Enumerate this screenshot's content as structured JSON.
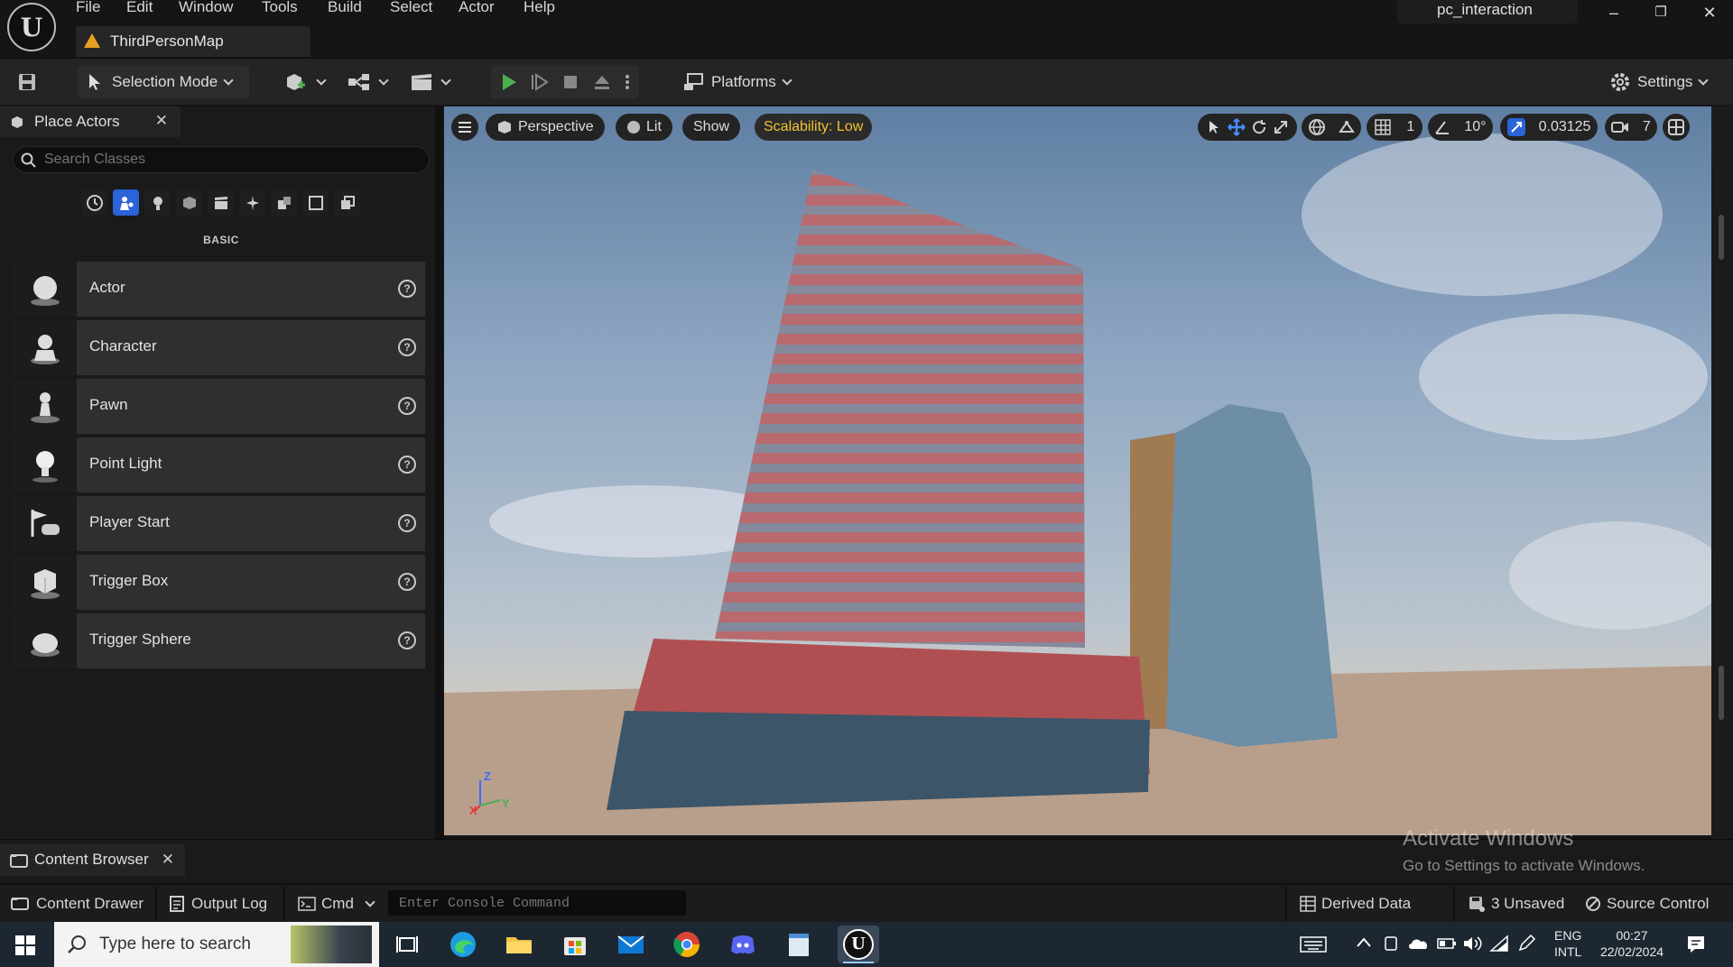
{
  "app": {
    "project_name": "pc_interaction",
    "map_tab": "ThirdPersonMap"
  },
  "menu": [
    "File",
    "Edit",
    "Window",
    "Tools",
    "Build",
    "Select",
    "Actor",
    "Help"
  ],
  "toolbar": {
    "selection_mode": "Selection Mode",
    "platforms": "Platforms",
    "settings": "Settings"
  },
  "place_actors": {
    "tab_title": "Place Actors",
    "search_placeholder": "Search Classes",
    "category_label": "BASIC",
    "items": [
      {
        "label": "Actor",
        "icon": "sphere-icon"
      },
      {
        "label": "Character",
        "icon": "character-icon"
      },
      {
        "label": "Pawn",
        "icon": "pawn-icon"
      },
      {
        "label": "Point Light",
        "icon": "light-bulb-icon"
      },
      {
        "label": "Player Start",
        "icon": "player-start-icon"
      },
      {
        "label": "Trigger Box",
        "icon": "trigger-box-icon"
      },
      {
        "label": "Trigger Sphere",
        "icon": "trigger-sphere-icon"
      }
    ]
  },
  "viewport": {
    "perspective": "Perspective",
    "lit": "Lit",
    "show": "Show",
    "scalability": "Scalability: Low",
    "grid_size": "1",
    "rotation_snap": "10°",
    "scale_snap": "0.03125",
    "camera_speed": "7",
    "axis_labels": {
      "z": "Z",
      "x": "X",
      "y": "Y"
    }
  },
  "content_browser": {
    "tab_title": "Content Browser"
  },
  "watermark": {
    "line1": "Activate Windows",
    "line2": "Go to Settings to activate Windows."
  },
  "statusbar": {
    "content_drawer": "Content Drawer",
    "output_log": "Output Log",
    "cmd": "Cmd",
    "console_placeholder": "Enter Console Command",
    "derived_data": "Derived Data",
    "unsaved": "3 Unsaved",
    "source_control": "Source Control"
  },
  "taskbar": {
    "search_placeholder": "Type here to search",
    "lang1": "ENG",
    "lang2": "INTL",
    "time": "00:27",
    "date": "22/02/2024"
  },
  "colors": {
    "accent": "#2b63d9",
    "play": "#4caf50",
    "scalability": "#f2c230",
    "warning": "#e8a020"
  }
}
